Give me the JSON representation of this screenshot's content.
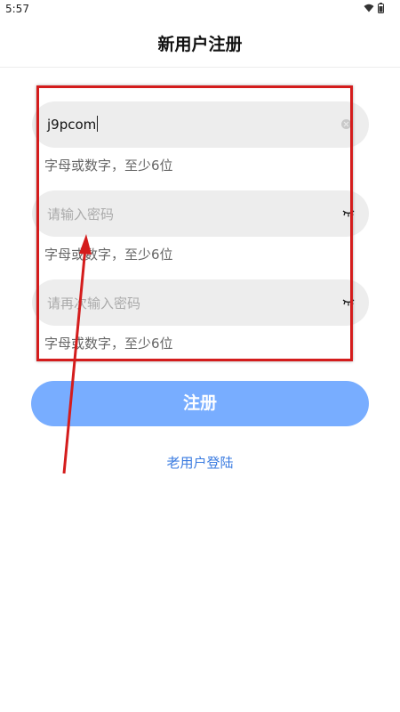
{
  "status_bar": {
    "time": "5:57"
  },
  "header": {
    "title": "新用户注册"
  },
  "form": {
    "username": {
      "value": "j9pcom",
      "hint": "字母或数字，至少6位"
    },
    "password": {
      "placeholder": "请输入密码",
      "hint": "字母或数字，至少6位"
    },
    "confirm_password": {
      "placeholder": "请再次输入密码",
      "hint": "字母或数字，至少6位"
    }
  },
  "actions": {
    "register_label": "注册",
    "login_link": "老用户登陆"
  },
  "colors": {
    "primary_button": "#78adff",
    "link": "#3a7be0",
    "annotation": "#d41c1c"
  },
  "icons": [
    "wifi-icon",
    "battery-icon",
    "clear-icon",
    "eye-closed-icon"
  ]
}
